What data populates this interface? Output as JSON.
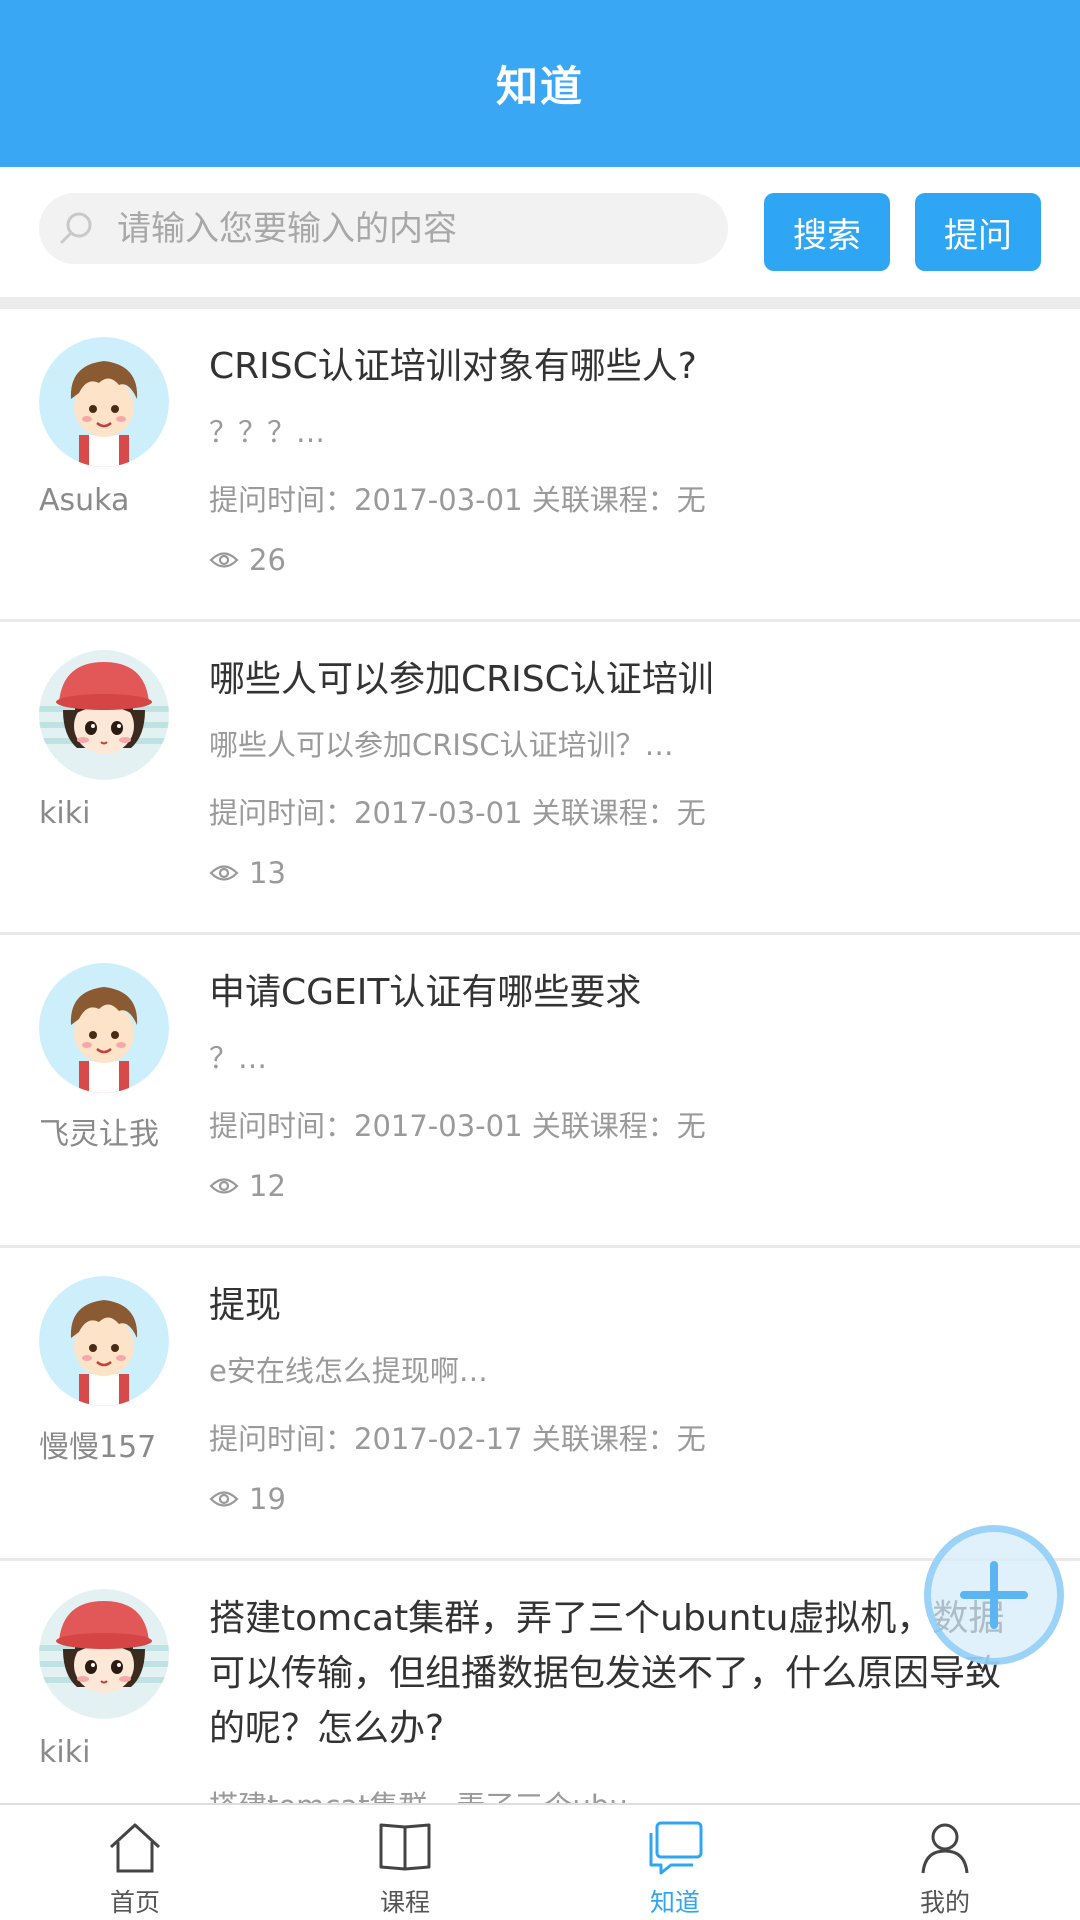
{
  "header": {
    "title": "知道"
  },
  "search": {
    "placeholder": "请输入您要输入的内容",
    "search_label": "搜索",
    "ask_label": "提问"
  },
  "questions": [
    {
      "avatar": "boy-avatar",
      "user": "Asuka",
      "title": "CRISC认证培训对象有哪些人?",
      "desc": "？？？…",
      "meta": "提问时间：2017-03-01 关联课程：无",
      "views": "26"
    },
    {
      "avatar": "girl-avatar",
      "user": "kiki",
      "title": "哪些人可以参加CRISC认证培训",
      "desc": "哪些人可以参加CRISC认证培训？…",
      "meta": "提问时间：2017-03-01 关联课程：无",
      "views": "13"
    },
    {
      "avatar": "boy-avatar",
      "user": "飞灵让我",
      "title": "申请CGEIT认证有哪些要求",
      "desc": "？…",
      "meta": "提问时间：2017-03-01 关联课程：无",
      "views": "12"
    },
    {
      "avatar": "boy-avatar",
      "user": "慢慢157",
      "title": "提现",
      "desc": "e安在线怎么提现啊…",
      "meta": "提问时间：2017-02-17 关联课程：无",
      "views": "19"
    },
    {
      "avatar": "girl-avatar",
      "user": "kiki",
      "title": "搭建tomcat集群，弄了三个ubuntu虚拟机，数据可以传输，但组播数据包发送不了，什么原因导致的呢？怎么办?",
      "desc": "搭建tomcat集群，弄了三个ubu…"
    }
  ],
  "tabs": [
    {
      "label": "首页",
      "icon": "home-icon"
    },
    {
      "label": "课程",
      "icon": "book-icon"
    },
    {
      "label": "知道",
      "icon": "chat-icon",
      "active": true
    },
    {
      "label": "我的",
      "icon": "user-icon"
    }
  ],
  "colors": {
    "primary": "#3aa7f5",
    "button": "#2fa6f3",
    "divider": "#e9e9e9"
  }
}
